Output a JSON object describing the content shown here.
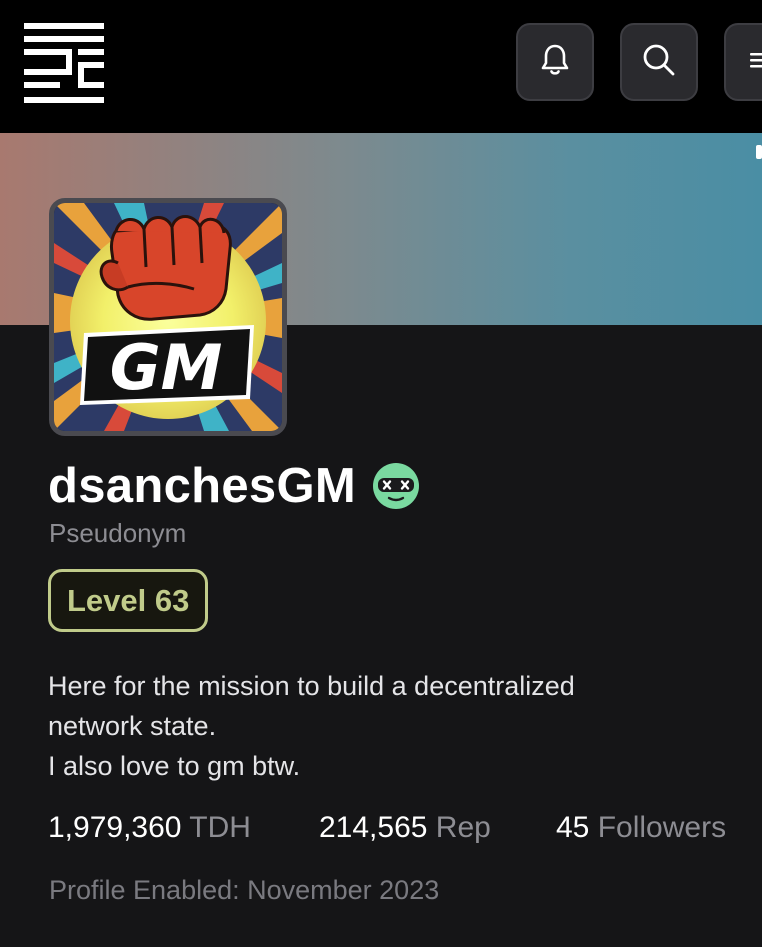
{
  "header": {
    "logo_icon": "brand-logo-icon",
    "notifications_icon": "bell-icon",
    "search_icon": "search-icon",
    "menu_icon": "menu-icon"
  },
  "banner": {
    "gradient_start": "#a8796f",
    "gradient_end": "#4a8ea4"
  },
  "profile": {
    "avatar_text": "GM",
    "display_name": "dsanchesGM",
    "badge_icon": "gamer-face-badge-icon",
    "badge_color": "#7ad9a0",
    "subtitle": "Pseudonym",
    "level_label": "Level 63",
    "level_color": "#c0cb8a",
    "bio": [
      "Here for the mission to build a decentralized",
      "network state.",
      "I also love to gm btw."
    ],
    "stats": {
      "tdh_value": "1,979,360",
      "tdh_label": "TDH",
      "rep_value": "214,565",
      "rep_label": "Rep",
      "followers_value": "45",
      "followers_label": "Followers"
    },
    "enabled": "Profile Enabled: November 2023"
  }
}
